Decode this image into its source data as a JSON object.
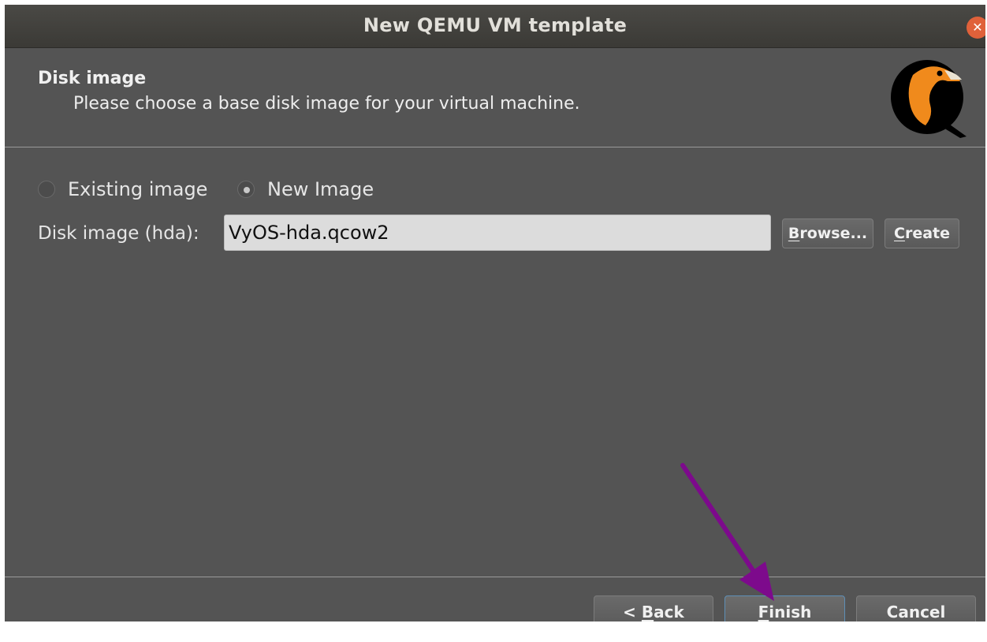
{
  "window": {
    "title": "New QEMU VM template"
  },
  "header": {
    "title": "Disk image",
    "subtitle": "Please choose a base disk image for your virtual machine."
  },
  "image_source": {
    "options": [
      {
        "label": "Existing image",
        "selected": false
      },
      {
        "label": "New Image",
        "selected": true
      }
    ]
  },
  "disk": {
    "label": "Disk image (hda):",
    "value": "VyOS-hda.qcow2",
    "browse": {
      "mnemonic": "B",
      "rest": "rowse..."
    },
    "create": {
      "mnemonic": "C",
      "rest": "reate"
    }
  },
  "footer": {
    "back": {
      "prefix": "< ",
      "mnemonic": "B",
      "rest": "ack"
    },
    "finish": {
      "mnemonic": "F",
      "rest": "inish"
    },
    "cancel": "Cancel"
  },
  "colors": {
    "background": "#545454",
    "annotation_arrow": "#7d0a8c",
    "logo_orange": "#f08a1c"
  },
  "annotation": {
    "icon": "pointer-arrow-icon",
    "target": "finish-button"
  }
}
